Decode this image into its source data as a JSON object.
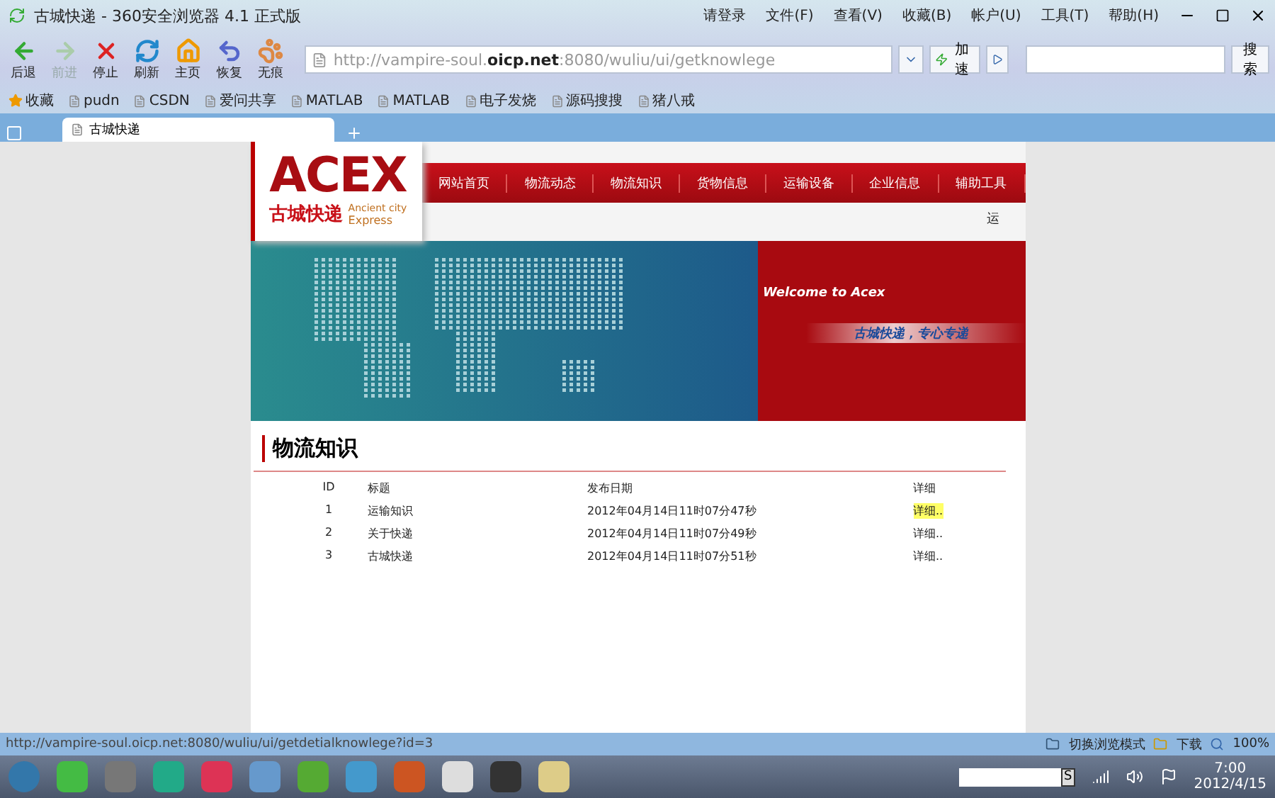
{
  "window": {
    "title": "古城快递 - 360安全浏览器 4.1 正式版"
  },
  "menu": [
    "请登录",
    "文件(F)",
    "查看(V)",
    "收藏(B)",
    "帐户(U)",
    "工具(T)",
    "帮助(H)"
  ],
  "toolbar": [
    {
      "label": "后退",
      "disabled": false
    },
    {
      "label": "前进",
      "disabled": true
    },
    {
      "label": "停止",
      "disabled": false
    },
    {
      "label": "刷新",
      "disabled": false
    },
    {
      "label": "主页",
      "disabled": false
    },
    {
      "label": "恢复",
      "disabled": false
    },
    {
      "label": "无痕",
      "disabled": false
    }
  ],
  "address": {
    "url": "http://vampire-soul.**oicp.net**:8080/wuliu/ui/getknowlege",
    "accelerate": "加速"
  },
  "search": {
    "button": "搜索"
  },
  "bookmarks": [
    "收藏",
    "pudn",
    "CSDN",
    "爱问共享",
    "MATLAB",
    "MATLAB",
    "电子发烧",
    "源码搜搜",
    "猪八戒"
  ],
  "tabs": [
    {
      "label": "古城快递",
      "selected": true
    }
  ],
  "page": {
    "logo": {
      "mark": "ACEX",
      "name": "古城快递",
      "english_1": "Ancient city",
      "english_2": "Express"
    },
    "nav": [
      "网站首页",
      "物流动态",
      "物流知识",
      "货物信息",
      "运输设备",
      "企业信息",
      "辅助工具"
    ],
    "marquee": "运",
    "banner": {
      "welcome": "Welcome to  Acex",
      "slogan": "古城快递，专心专递"
    },
    "section_title": "物流知识",
    "table": {
      "columns": [
        "ID",
        "标题",
        "发布日期",
        "详细"
      ],
      "rows": [
        {
          "id": "1",
          "title": "运输知识",
          "date": "2012年04月14日11时07分47秒",
          "link": "详细..",
          "hovered": true
        },
        {
          "id": "2",
          "title": "关于快递",
          "date": "2012年04月14日11时07分49秒",
          "link": "详细..",
          "hovered": false
        },
        {
          "id": "3",
          "title": "古城快递",
          "date": "2012年04月14日11时07分51秒",
          "link": "详细..",
          "hovered": false
        }
      ]
    }
  },
  "status_bar": {
    "url": "http://vampire-soul.oicp.net:8080/wuliu/ui/getdetialknowlege?id=3",
    "mode": "切换浏览模式",
    "download": "下载",
    "zoom": "100%"
  },
  "taskbar": {
    "input_key": "S",
    "time": "7:00",
    "date": "2012/4/15"
  }
}
